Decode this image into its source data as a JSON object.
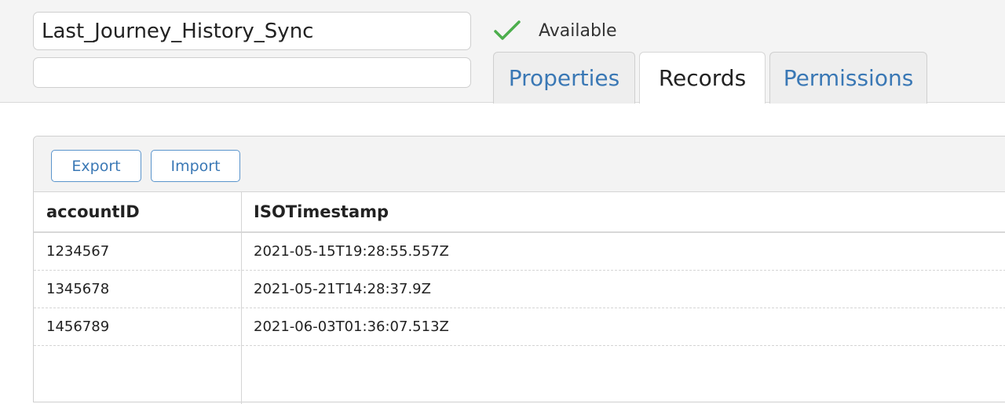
{
  "record": {
    "name": "Last_Journey_History_Sync",
    "description": ""
  },
  "status": {
    "icon": "check-icon",
    "text": "Available",
    "color": "#4cae4c"
  },
  "tabs": [
    {
      "label": "Properties",
      "active": false
    },
    {
      "label": "Records",
      "active": true
    },
    {
      "label": "Permissions",
      "active": false
    }
  ],
  "toolbar": {
    "export_label": "Export",
    "import_label": "Import"
  },
  "table": {
    "columns": [
      "accountID",
      "ISOTimestamp"
    ],
    "rows": [
      [
        "1234567",
        "2021-05-15T19:28:55.557Z"
      ],
      [
        "1345678",
        "2021-05-21T14:28:37.9Z"
      ],
      [
        "1456789",
        "2021-06-03T01:36:07.513Z"
      ]
    ]
  },
  "colors": {
    "accent": "#3a78b5",
    "header_bg": "#f4f4f4"
  }
}
